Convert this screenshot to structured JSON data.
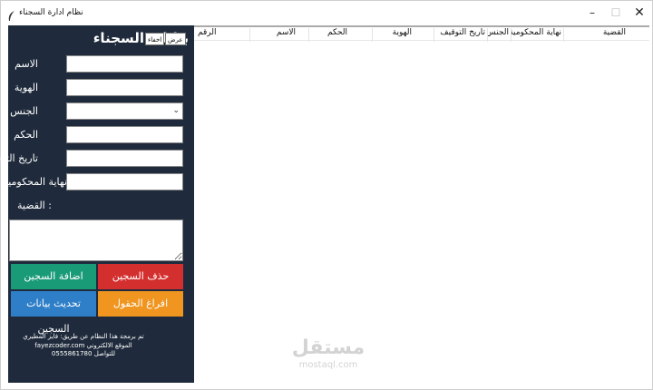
{
  "window": {
    "title": "نظام ادارة السجناء",
    "minimize_icon": "–",
    "maximize_icon": "☐",
    "close_icon": "✕"
  },
  "panel": {
    "title": "بيانات السجناء",
    "show_button": "عرض",
    "hide_button": "اخفاء",
    "fields": {
      "name": {
        "label": "الاسم",
        "value": ""
      },
      "id": {
        "label": "الهوية",
        "value": ""
      },
      "gender": {
        "label": "الجنس",
        "value": ""
      },
      "sentence": {
        "label": "الحكم",
        "value": ""
      },
      "arrest_date": {
        "label": "تاريخ التوقيف",
        "value": ""
      },
      "sentence_end": {
        "label": "نهاية المحكومية",
        "value": ""
      }
    },
    "case_label": ": القضية",
    "case_value": "",
    "buttons": {
      "add": "اضافة السجين",
      "delete": "حذف السجين",
      "update": "تحديث بيانات السجين",
      "clear": "افراغ الحقول"
    },
    "credits": {
      "line1": "تم برمجة هذا النظام عن طريق: فايز المطيري",
      "line2": "الموقع الالكتروني fayezcoder.com",
      "line3": "للتواصل 0555861780"
    }
  },
  "table": {
    "columns": [
      "الرقم",
      "الاسم",
      "الحكم",
      "الهوية",
      "تاريخ التوقيف",
      "الجنس",
      "نهاية المحكومية",
      "القضية"
    ],
    "rows": []
  },
  "watermark": {
    "arabic": "مستقل",
    "latin": "mostaql.com"
  },
  "colors": {
    "panel_bg": "#1f2b3c",
    "add": "#1a9b78",
    "delete": "#d42f2f",
    "update": "#2f7fc8",
    "clear": "#ef9520"
  }
}
